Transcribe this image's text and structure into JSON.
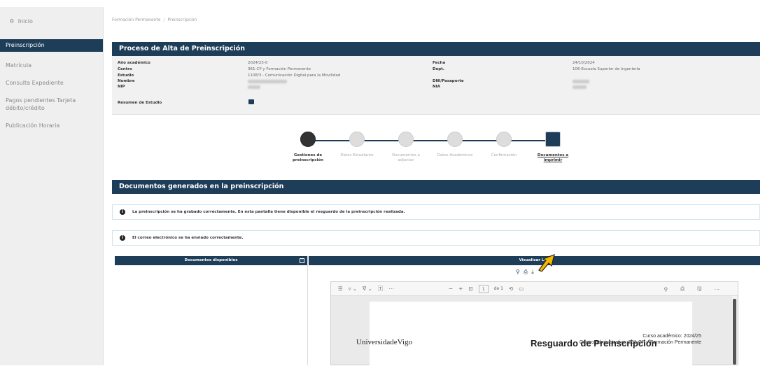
{
  "sidebar": {
    "home_label": "Inicio",
    "active_item": "Preinscripción",
    "items": [
      {
        "label": "Matrícula"
      },
      {
        "label": "Consulta Expediente"
      },
      {
        "label": "Pagos pendientes Tarjeta débito/crédito"
      },
      {
        "label": "Publicación Horaria"
      }
    ]
  },
  "breadcrumb": {
    "part1": "Formación Permanente",
    "part2": "Preinscripción"
  },
  "process": {
    "title": "Proceso de Alta de Preinscripción",
    "labels": {
      "anio": "Año académico",
      "centro": "Centro",
      "estudio": "Estudio",
      "nombre": "Nombre",
      "nip": "NIP",
      "resumen": "Resumen de Estudio",
      "fecha": "Fecha",
      "dept": "Dept.",
      "dni": "DNI/Pasaporte",
      "nia": "NIA"
    },
    "values": {
      "anio": "2024/25-0",
      "centro": "361-CP y Formación Permanente",
      "estudio": "1108/3 - Comunicación Digital para la Movilidad",
      "fecha": "24/10/2024",
      "dept": "106-Escuela Superior de Ingeniería"
    }
  },
  "stepper": {
    "steps": [
      {
        "label": "Gestiones de preinscripción"
      },
      {
        "label": "Datos Estudiante"
      },
      {
        "label": "Documentos a adjuntar"
      },
      {
        "label": "Datos Académicos"
      },
      {
        "label": "Confirmación"
      },
      {
        "label": "Documentos a imprimir"
      }
    ]
  },
  "documents": {
    "title": "Documentos generados en la preinscripción",
    "alert1": "La preinscripción se ha grabado correctamente. En esta pantalla tiene disponible el resguardo de la preinscripción realizada.",
    "alert2": "El correo electrónico se ha enviado correctamente.",
    "available_header": "Documentos disponibles",
    "viewer_header": "Visualizar Doc"
  },
  "pdf": {
    "page_current": "1",
    "page_total": "de 1",
    "doc_title": "Resguardo de Preinscripción",
    "curso": "Curso académico: 2024/25",
    "centro": "Centro administrativo: 361-CP y Formación Permanente",
    "logo_text": "UniversidadeVigo"
  }
}
